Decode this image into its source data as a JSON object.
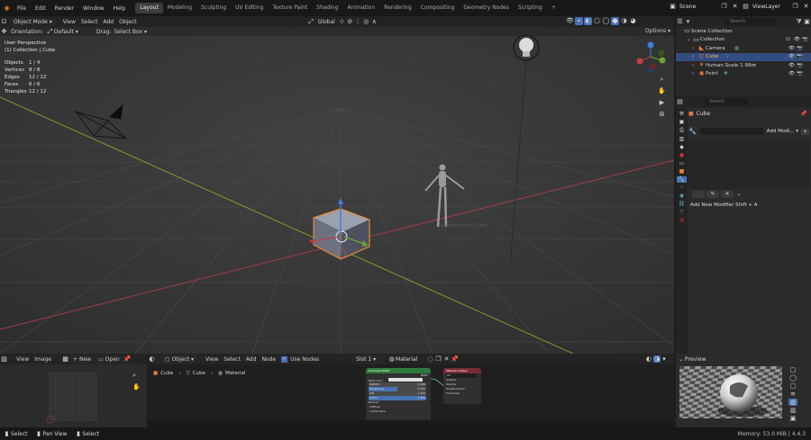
{
  "topbar": {
    "menu": [
      "File",
      "Edit",
      "Render",
      "Window",
      "Help"
    ],
    "workspaces": [
      "Layout",
      "Modeling",
      "Sculpting",
      "UV Editing",
      "Texture Paint",
      "Shading",
      "Animation",
      "Rendering",
      "Compositing",
      "Geometry Nodes",
      "Scripting"
    ],
    "active": "Layout",
    "add": "+",
    "scene": "Scene",
    "viewlayer": "ViewLayer"
  },
  "vp_header": {
    "mode": "Object Mode",
    "menus": [
      "View",
      "Select",
      "Add",
      "Object"
    ],
    "transform": "Global",
    "options": "Options"
  },
  "tool_settings": {
    "orientation_label": "Orientation:",
    "orientation": "Default",
    "drag_label": "Drag:",
    "drag": "Select Box"
  },
  "overlay": {
    "view_name": "User Perspective",
    "collection": "(1) Collection | Cube",
    "stats": [
      {
        "k": "Objects",
        "v": "1 / 4"
      },
      {
        "k": "Vertices",
        "v": "8 / 8"
      },
      {
        "k": "Edges",
        "v": "12 / 12"
      },
      {
        "k": "Faces",
        "v": "6 / 6"
      },
      {
        "k": "Triangles",
        "v": "12 / 12"
      }
    ]
  },
  "scene": {
    "human_label": "Human Scale 1.98m"
  },
  "outliner": {
    "search": "Search",
    "rows": [
      {
        "label": "Scene Collection",
        "indent": 0
      },
      {
        "label": "Collection",
        "indent": 1
      },
      {
        "label": "Camera",
        "indent": 2
      },
      {
        "label": "Cube",
        "indent": 2,
        "selected": true
      },
      {
        "label": "Human Scale 1.98m",
        "indent": 2
      },
      {
        "label": "Point",
        "indent": 2
      }
    ]
  },
  "properties": {
    "search": "Search",
    "object": "Cube",
    "add_modifier": "Add Modi...",
    "hint": "Add New Modifier Shift + A"
  },
  "image_editor": {
    "menus": [
      "View",
      "Image"
    ],
    "new": "New",
    "open": "Open"
  },
  "node_editor": {
    "object": "Object",
    "menus": [
      "View",
      "Select",
      "Add",
      "Node"
    ],
    "use_nodes": "Use Nodes",
    "slot": "Slot 1",
    "material": "Material",
    "breadcrumb": [
      "Cube",
      "Cube",
      "Material"
    ],
    "bsdf": {
      "title": "Principled BSDF",
      "out": "BSDF",
      "rows": [
        "Base Color",
        "Metallic",
        "Roughness",
        "IOR",
        "Alpha",
        "Normal",
        "Diffuse",
        "Subsurface"
      ],
      "vals": [
        "",
        "0.000",
        "0.500",
        "1.450",
        "1.000",
        "",
        "",
        ""
      ]
    },
    "output": {
      "title": "Material Output",
      "target": "All",
      "rows": [
        "Surface",
        "Volume",
        "Displacement",
        "Thickness"
      ]
    }
  },
  "preview": {
    "title": "Preview"
  },
  "status": {
    "items": [
      "Select",
      "Pan View",
      "Select"
    ],
    "memory": "Memory: 53.0 MiB | 4.4.3"
  },
  "colors": {
    "accent": "#4772b3",
    "selected_outline": "#e9892f",
    "bsdf_header": "#2f7a3b",
    "output_header": "#7b2b38",
    "axis_x": "#a33d48",
    "axis_y": "#809a2c"
  }
}
